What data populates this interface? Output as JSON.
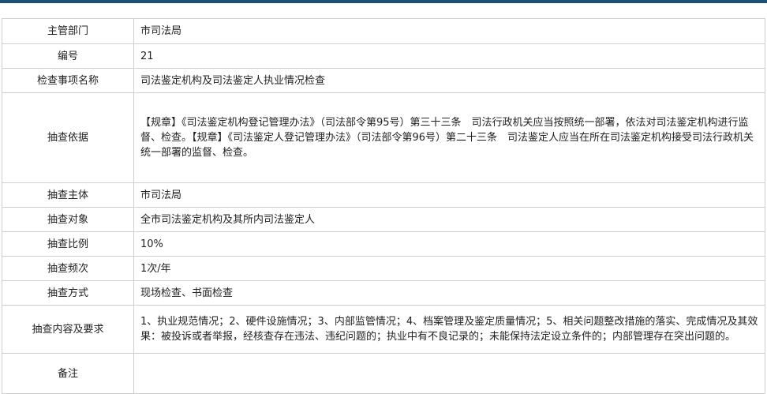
{
  "rows": [
    {
      "label": "主管部门",
      "value": "市司法局"
    },
    {
      "label": "编号",
      "value": "21"
    },
    {
      "label": "检查事项名称",
      "value": "司法鉴定机构及司法鉴定人执业情况检查"
    },
    {
      "label": "抽查依据",
      "value": "【规章】《司法鉴定机构登记管理办法》（司法部令第95号）第三十三条　司法行政机关应当按照统一部署，依法对司法鉴定机构进行监督、检查。【规章】《司法鉴定人登记管理办法》（司法部令第96号）第二十三条　司法鉴定人应当在所在司法鉴定机构接受司法行政机关统一部署的监督、检查。"
    },
    {
      "label": "抽查主体",
      "value": "市司法局"
    },
    {
      "label": "抽查对象",
      "value": "全市司法鉴定机构及其所内司法鉴定人"
    },
    {
      "label": "抽查比例",
      "value": "10%"
    },
    {
      "label": "抽查频次",
      "value": "1次/年"
    },
    {
      "label": "抽查方式",
      "value": "现场检查、书面检查"
    },
    {
      "label": "抽查内容及要求",
      "value": "1、执业规范情况；2、硬件设施情况；3、内部监管情况；4、档案管理及鉴定质量情况；5、相关问题整改措施的落实、完成情况及其效果：被投诉或者举报，经核查存在违法、违纪问题的；执业中有不良记录的；未能保持法定设立条件的；内部管理存在突出问题的。"
    },
    {
      "label": "备注",
      "value": ""
    }
  ]
}
